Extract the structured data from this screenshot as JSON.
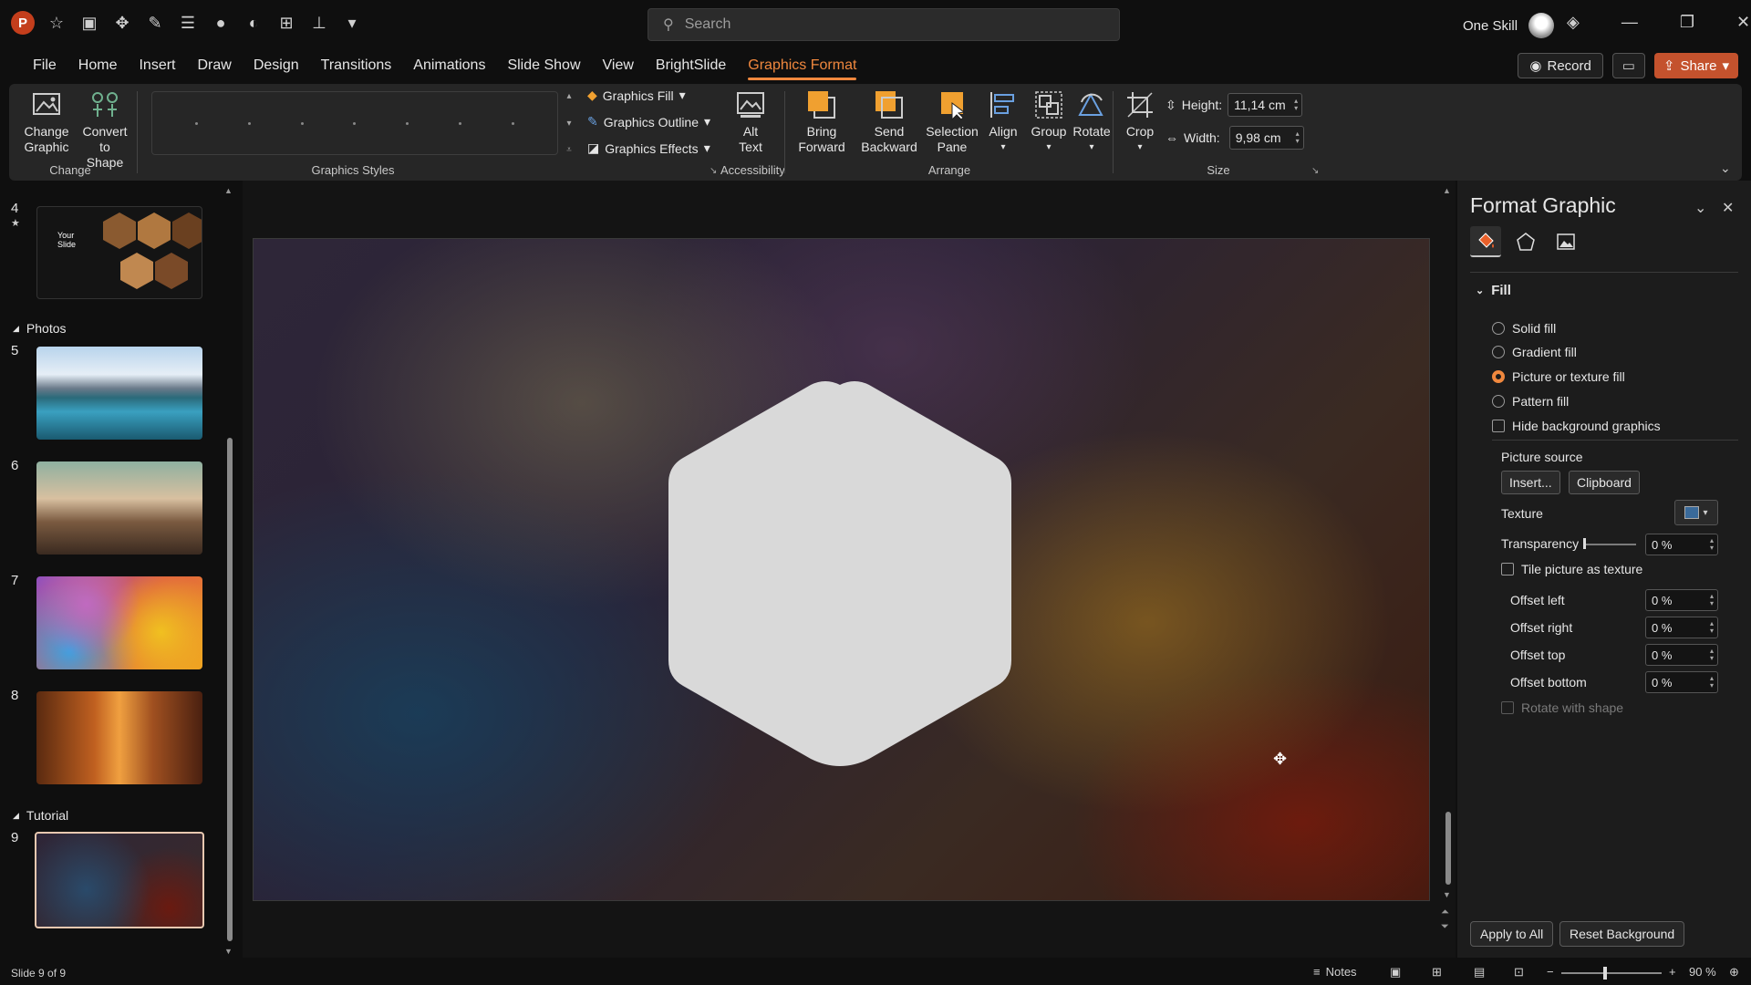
{
  "titlebar": {
    "search_placeholder": "Search",
    "user_name": "One Skill"
  },
  "menu": {
    "tabs": [
      "File",
      "Home",
      "Insert",
      "Draw",
      "Design",
      "Transitions",
      "Animations",
      "Slide Show",
      "View",
      "BrightSlide",
      "Graphics Format"
    ],
    "active_tab": "Graphics Format",
    "record_label": "Record",
    "share_label": "Share"
  },
  "ribbon": {
    "change": {
      "label": "Change",
      "change_graphic": "Change Graphic",
      "convert_to_shape": "Convert to Shape"
    },
    "graphics_styles": {
      "label": "Graphics Styles",
      "fill": "Graphics Fill",
      "outline": "Graphics Outline",
      "effects": "Graphics Effects"
    },
    "accessibility": {
      "label": "Accessibility",
      "alt_text": "Alt Text"
    },
    "arrange": {
      "label": "Arrange",
      "bring_forward": "Bring Forward",
      "send_backward": "Send Backward",
      "selection_pane": "Selection Pane",
      "align": "Align",
      "group": "Group",
      "rotate": "Rotate"
    },
    "size": {
      "label": "Size",
      "crop": "Crop",
      "height_label": "Height:",
      "height_value": "11,14 cm",
      "width_label": "Width:",
      "width_value": "9,98 cm"
    }
  },
  "thumbnails": {
    "sections": [
      {
        "name": "Photos"
      },
      {
        "name": "Tutorial"
      }
    ],
    "slides": [
      {
        "num": "4",
        "title_line1": "Your",
        "title_line2": "Slide"
      },
      {
        "num": "5"
      },
      {
        "num": "6"
      },
      {
        "num": "7"
      },
      {
        "num": "8"
      },
      {
        "num": "9"
      }
    ]
  },
  "format_pane": {
    "title": "Format Graphic",
    "section": "Fill",
    "options": {
      "solid": "Solid fill",
      "gradient": "Gradient fill",
      "picture": "Picture or texture fill",
      "pattern": "Pattern fill",
      "hide_bg": "Hide background graphics"
    },
    "selected_option": "Picture or texture fill",
    "picture_source": "Picture source",
    "insert_btn": "Insert...",
    "clipboard_btn": "Clipboard",
    "texture_label": "Texture",
    "transparency_label": "Transparency",
    "transparency_value": "0 %",
    "tile_label": "Tile picture as texture",
    "offset_left_label": "Offset left",
    "offset_left_value": "0 %",
    "offset_right_label": "Offset right",
    "offset_right_value": "0 %",
    "offset_top_label": "Offset top",
    "offset_top_value": "0 %",
    "offset_bottom_label": "Offset bottom",
    "offset_bottom_value": "0 %",
    "rotate_label": "Rotate with shape",
    "apply_all": "Apply to All",
    "reset_bg": "Reset Background"
  },
  "statusbar": {
    "slide_info": "Slide 9 of 9",
    "notes": "Notes",
    "zoom": "90 %"
  },
  "colors": {
    "accent": "#f0883e",
    "share": "#c4522d",
    "hexagon_fill": "#d9d9d9"
  }
}
